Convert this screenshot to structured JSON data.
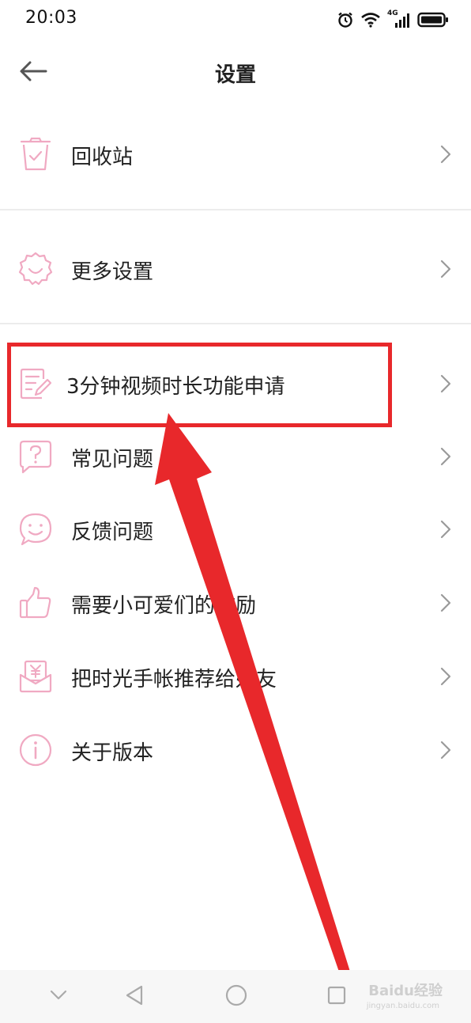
{
  "status_bar": {
    "time": "20:03",
    "network": "4G",
    "icons": [
      "alarm-icon",
      "wifi-icon",
      "signal-icon",
      "battery-icon"
    ]
  },
  "header": {
    "title": "设置",
    "back_icon": "arrow-left-icon"
  },
  "menu": {
    "items": [
      {
        "label": "回收站",
        "icon": "trash-icon"
      },
      {
        "label": "更多设置",
        "icon": "settings-gear-icon"
      },
      {
        "label": "3分钟视频时长功能申请",
        "icon": "edit-document-icon"
      },
      {
        "label": "常见问题",
        "icon": "question-bubble-icon"
      },
      {
        "label": "反馈问题",
        "icon": "smile-bubble-icon"
      },
      {
        "label": "需要小可爱们的鼓励",
        "icon": "thumbs-up-icon"
      },
      {
        "label": "把时光手帐推荐给好友",
        "icon": "yuan-envelope-icon"
      },
      {
        "label": "关于版本",
        "icon": "info-icon"
      }
    ]
  },
  "annotation": {
    "highlight_color": "#e8282b",
    "highlighted_item_index": 2
  },
  "theme": {
    "icon_color": "#f0a9c2",
    "chevron_color": "#9a9a9a"
  },
  "nav_bar": {
    "buttons": [
      "chevron-down-icon",
      "back-triangle-icon",
      "home-circle-icon",
      "recents-square-icon"
    ]
  },
  "watermark": {
    "text": "Baidu经验",
    "sub": "jingyan.baidu.com"
  }
}
